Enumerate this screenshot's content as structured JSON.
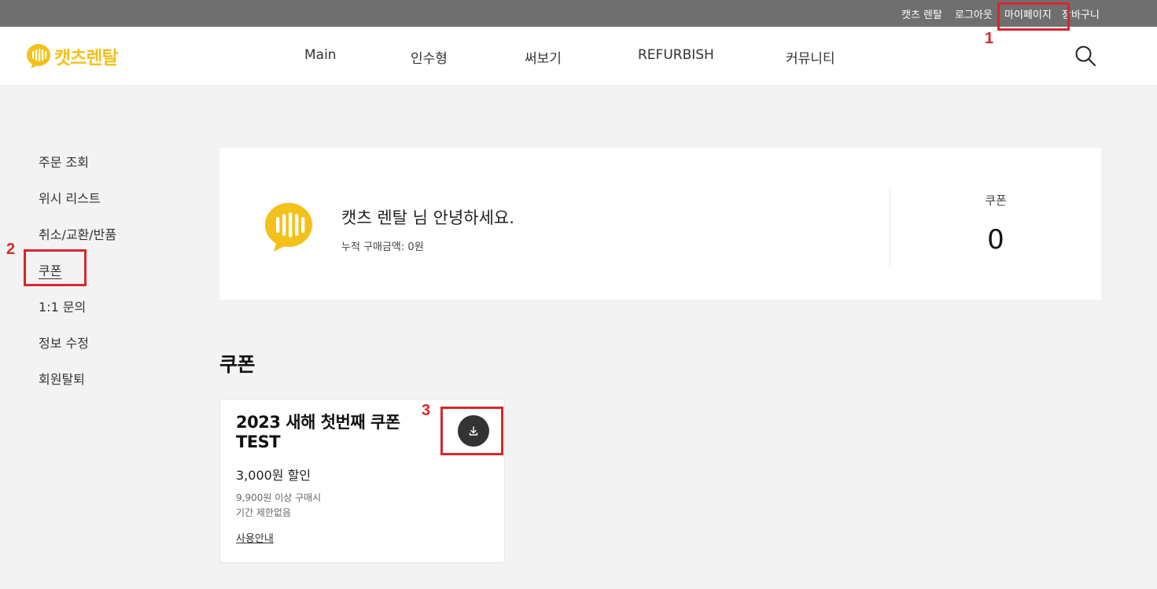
{
  "topbar": {
    "user_name": "캣츠 렌탈",
    "logout": "로그아웃",
    "mypage": "마이페이지",
    "cart": "장바구니"
  },
  "header": {
    "logo_text": "캣츠렌탈",
    "nav": [
      "Main",
      "인수형",
      "써보기",
      "REFURBISH",
      "커뮤니티"
    ],
    "search_icon": "search-icon"
  },
  "sidebar": {
    "items": [
      "주문 조회",
      "위시 리스트",
      "취소/교환/반품",
      "쿠폰",
      "1:1 문의",
      "정보 수정",
      "회원탈퇴"
    ],
    "active": "쿠폰"
  },
  "profile": {
    "greeting": "캣츠 렌탈 님 안녕하세요.",
    "purchase_label": "누적 구매금액:",
    "purchase_value": "0원",
    "coupon_label": "쿠폰",
    "coupon_count": "0"
  },
  "section": {
    "title": "쿠폰"
  },
  "coupon": {
    "title": "2023 새해 첫번째 쿠폰 TEST",
    "discount": "3,000원 할인",
    "condition": "9,900원 이상 구매시",
    "period": "기간 제한없음",
    "guide": "사용안내",
    "download_icon": "download-icon"
  },
  "annotations": [
    "1",
    "2",
    "3"
  ],
  "colors": {
    "topbar_bg": "#6f6f6f",
    "brand_yellow": "#f4c11a",
    "annotation_red": "#d9262c",
    "page_bg": "#f3f3f3"
  }
}
